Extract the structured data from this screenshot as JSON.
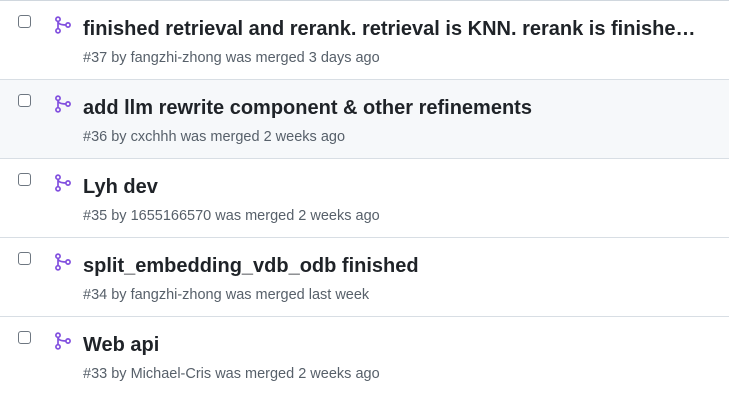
{
  "pull_requests": [
    {
      "title": "finished retrieval and rerank. retrieval is KNN. rerank is finished b...",
      "number": "#37",
      "by": "by",
      "author": "fangzhi-zhong",
      "status": "was merged",
      "time": "3 days ago"
    },
    {
      "title": "add llm rewrite component & other refinements",
      "number": "#36",
      "by": "by",
      "author": "cxchhh",
      "status": "was merged",
      "time": "2 weeks ago"
    },
    {
      "title": "Lyh dev",
      "number": "#35",
      "by": "by",
      "author": "1655166570",
      "status": "was merged",
      "time": "2 weeks ago"
    },
    {
      "title": "split_embedding_vdb_odb finished",
      "number": "#34",
      "by": "by",
      "author": "fangzhi-zhong",
      "status": "was merged",
      "time": "last week"
    },
    {
      "title": "Web api",
      "number": "#33",
      "by": "by",
      "author": "Michael-Cris",
      "status": "was merged",
      "time": "2 weeks ago"
    }
  ],
  "colors": {
    "merged_icon": "#8250df",
    "title_text": "#1f2328",
    "meta_text": "#57606a",
    "border": "#d8dee4",
    "hover_row": "#f6f8fa"
  },
  "icons": {
    "merged": "git-merge-icon",
    "select": "checkbox"
  }
}
